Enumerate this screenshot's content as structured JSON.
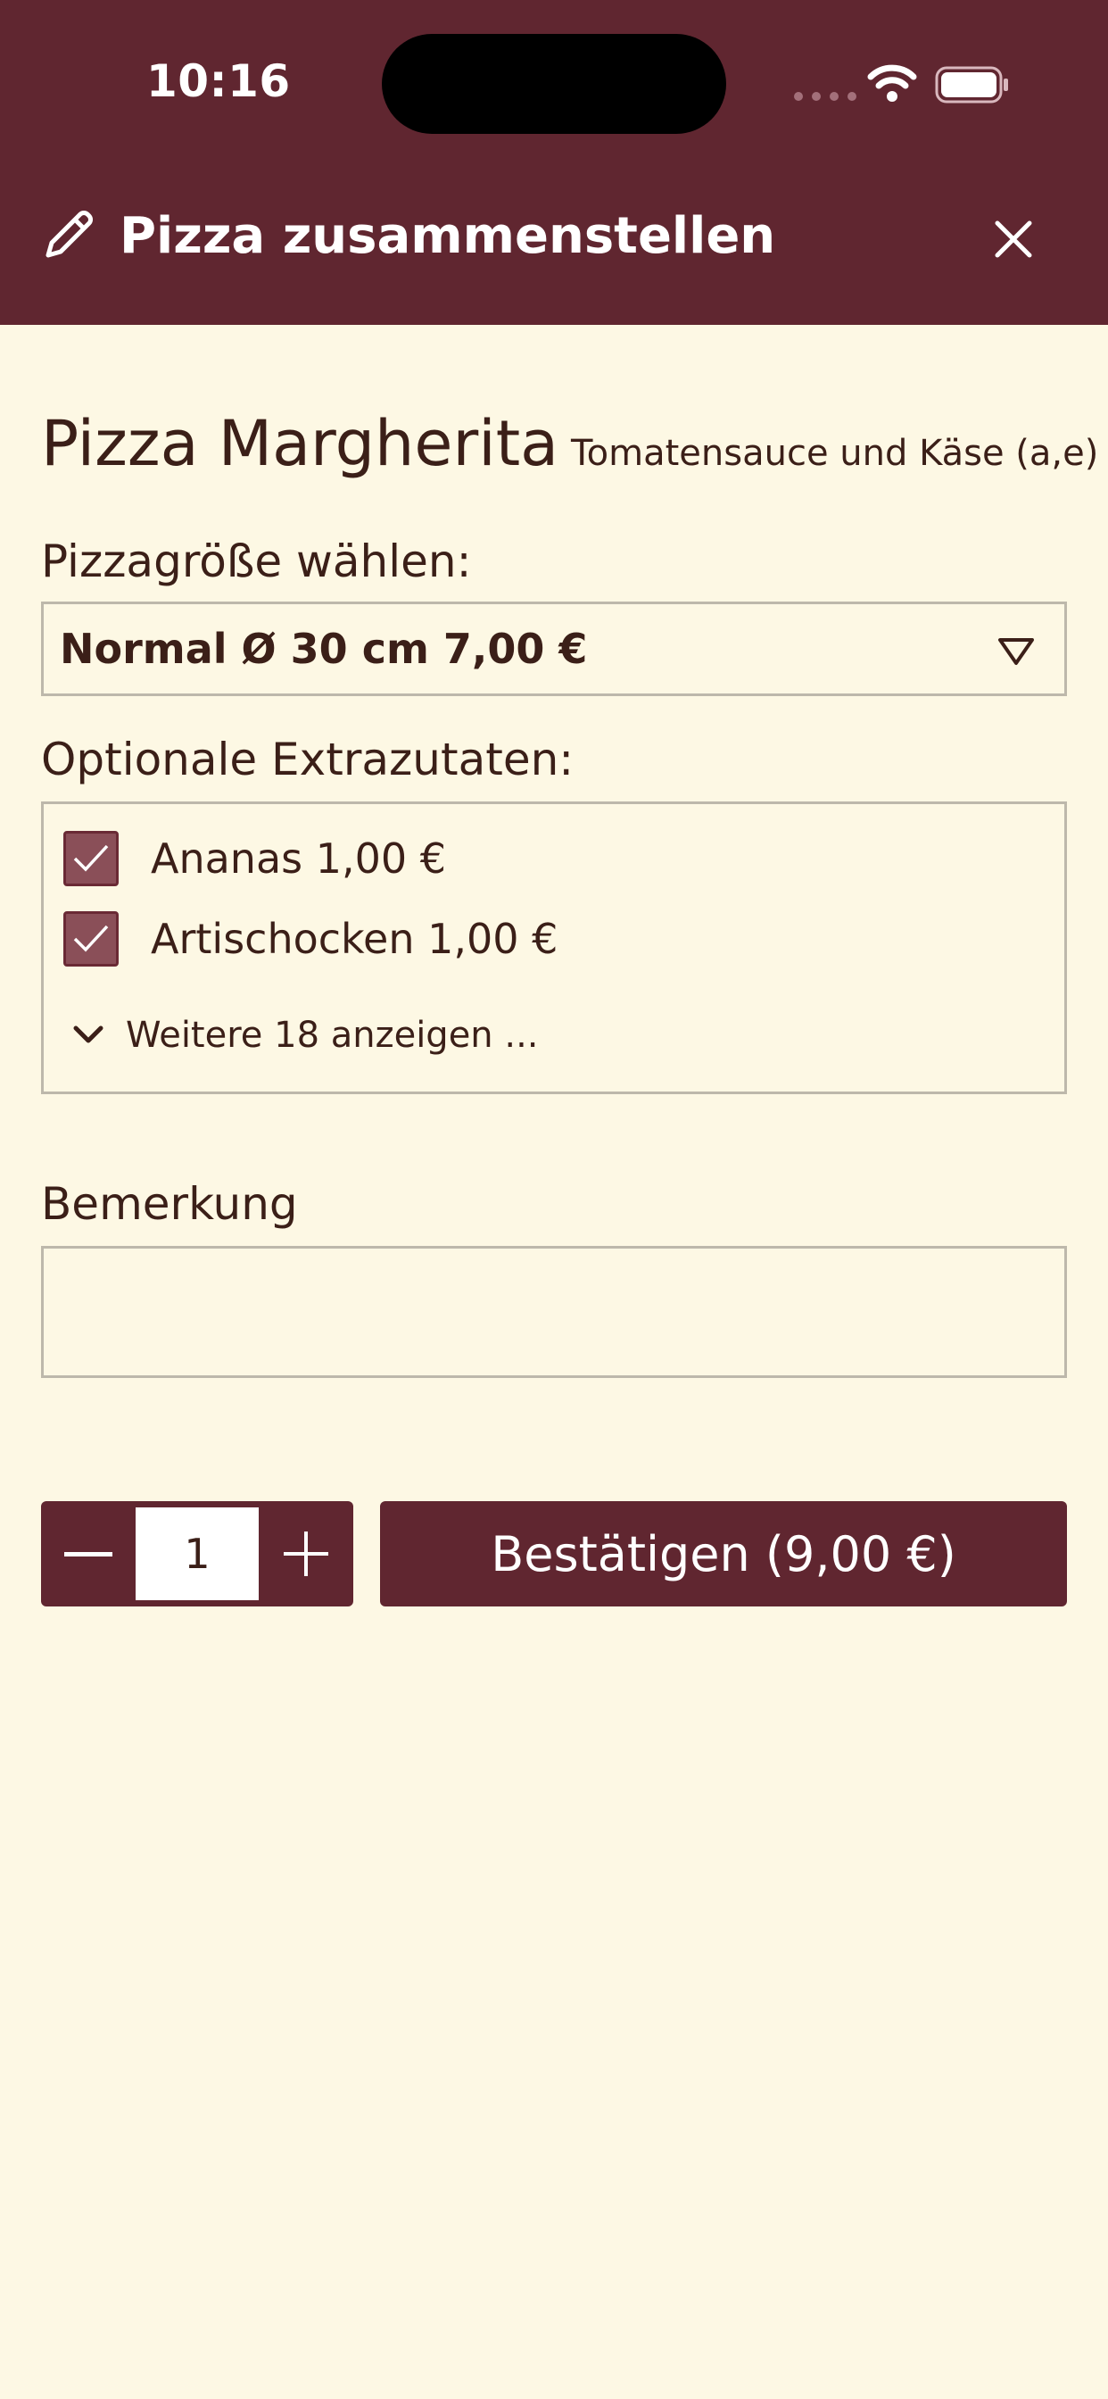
{
  "status_bar": {
    "time": "10:16"
  },
  "header": {
    "title": "Pizza zusammenstellen",
    "icon": "pencil-icon",
    "close_icon": "close-icon",
    "background": "#602630"
  },
  "product": {
    "name": "Pizza Margherita",
    "description": "Tomatensauce und Käse (a,e)"
  },
  "size": {
    "label": "Pizzagröße wählen:",
    "selected": "Normal Ø 30 cm 7,00 €"
  },
  "extras": {
    "label": "Optionale Extrazutaten:",
    "items": [
      {
        "label": "Ananas 1,00 €",
        "checked": true
      },
      {
        "label": "Artischocken 1,00 €",
        "checked": true
      }
    ],
    "more_label": "Weitere 18 anzeigen ..."
  },
  "remark": {
    "label": "Bemerkung",
    "value": "",
    "placeholder": ""
  },
  "quantity": {
    "value": "1"
  },
  "confirm": {
    "label": "Bestätigen (9,00 €)"
  },
  "colors": {
    "accent": "#602630",
    "background": "#fdf8e4",
    "checkbox": "#8a4f58",
    "text": "#3b1f18"
  }
}
